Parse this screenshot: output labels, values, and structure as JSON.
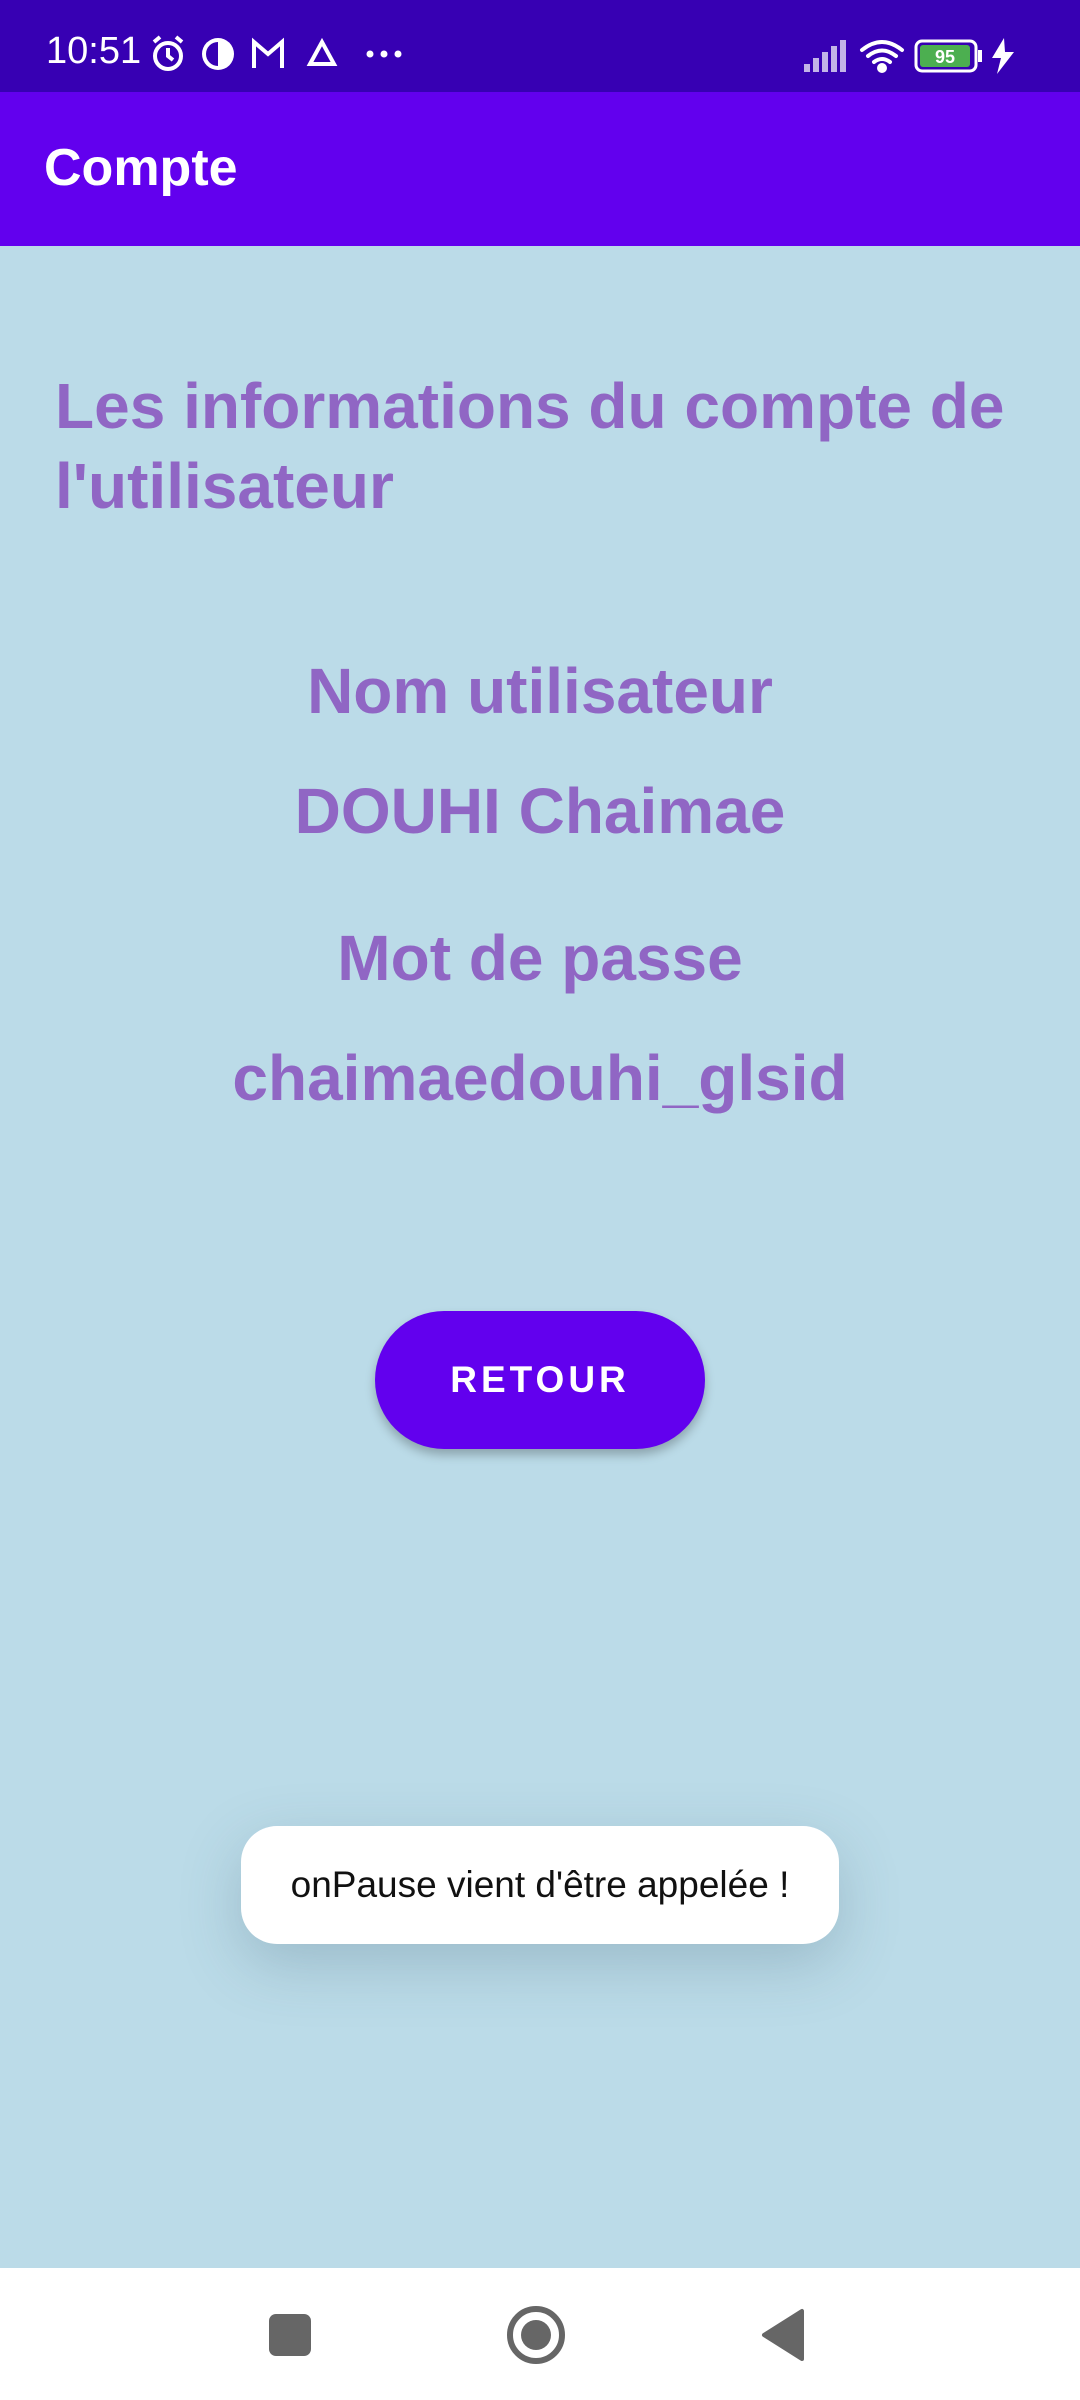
{
  "status_bar": {
    "time": "10:51",
    "battery": "95",
    "icons": [
      "alarm-icon",
      "contrast-icon",
      "gmail-icon",
      "drive-icon",
      "more-icon",
      "signal-icon",
      "wifi-icon",
      "battery-icon",
      "charging-icon"
    ]
  },
  "app_bar": {
    "title": "Compte"
  },
  "main": {
    "heading": "Les informations du compte de l'utilisateur",
    "username_label": "Nom utilisateur",
    "username_value": "DOUHI Chaimae",
    "password_label": "Mot de passe",
    "password_value": "chaimaedouhi_glsid",
    "back_button": "RETOUR"
  },
  "toast": {
    "message": "onPause vient d'être appelée !"
  },
  "nav_bar": {
    "buttons": [
      "recents-button",
      "home-button",
      "back-button"
    ]
  },
  "colors": {
    "status_bar": "#3700b3",
    "app_bar": "#6200ee",
    "background": "#bbdbe8",
    "text_purple": "#9066c4",
    "button": "#6200ee"
  }
}
